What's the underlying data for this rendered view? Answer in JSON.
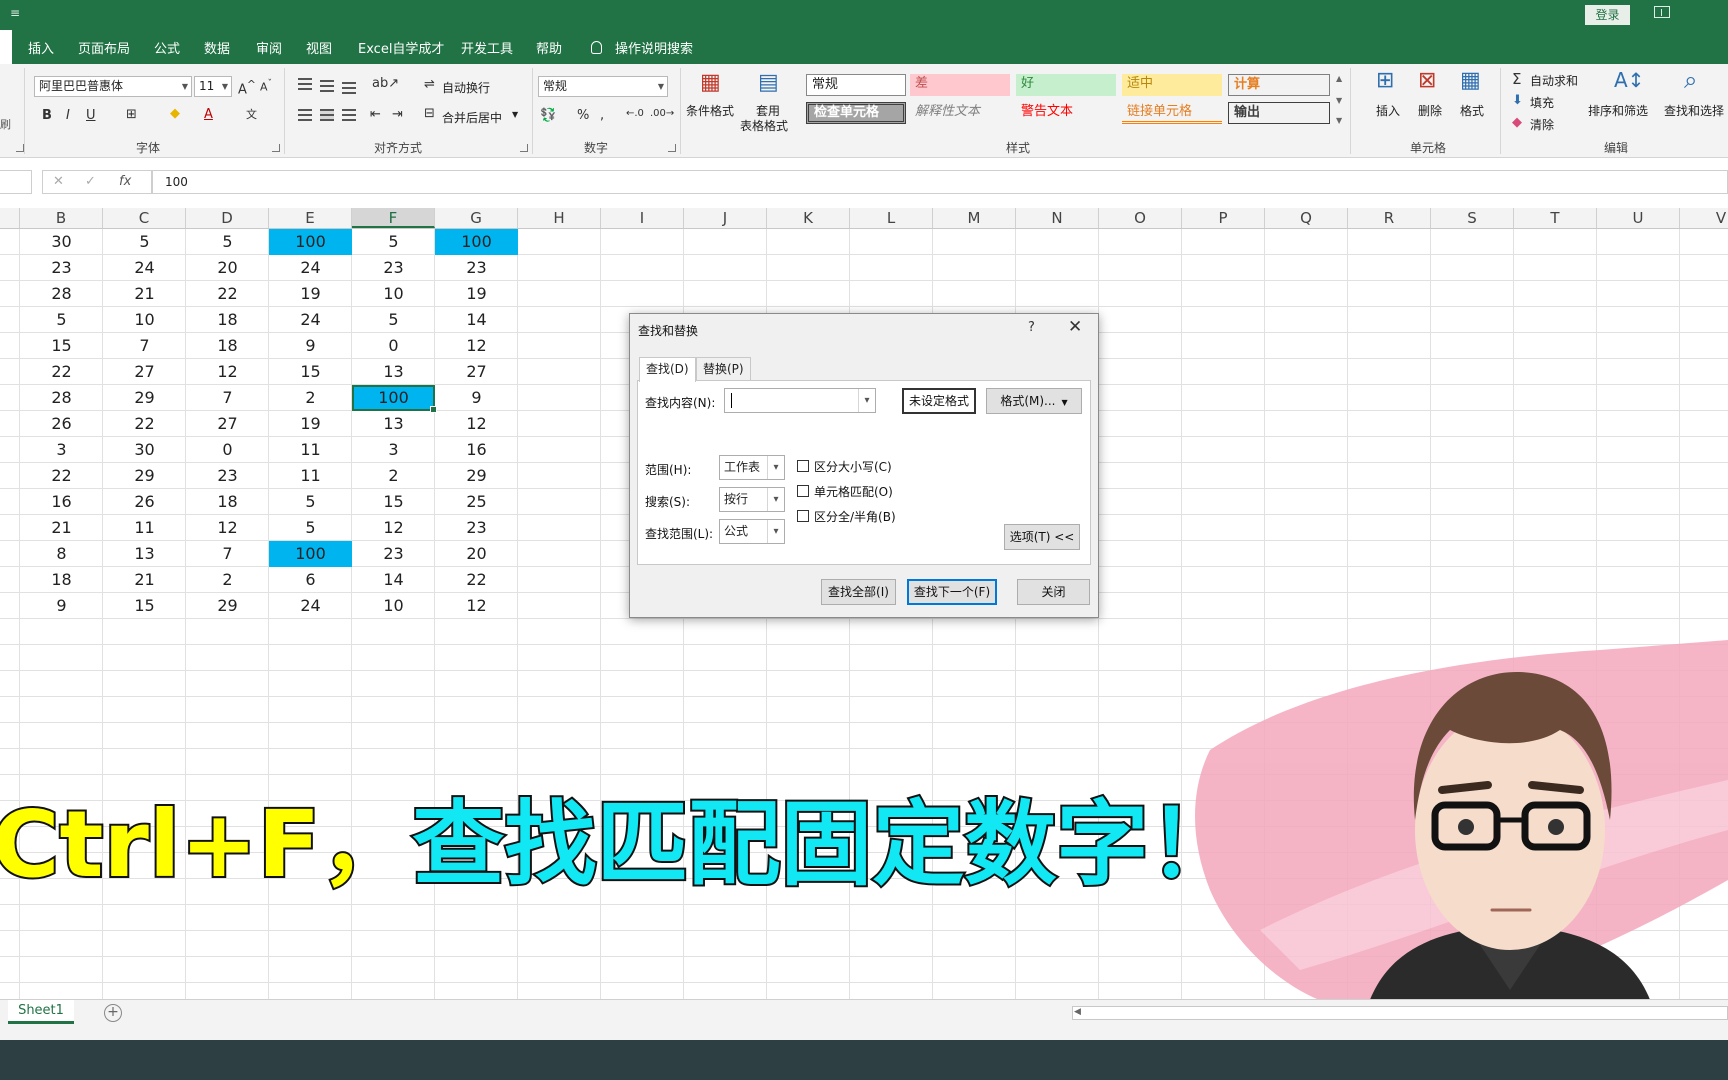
{
  "titlebar": {
    "qat_mark": "≡",
    "login": "登录"
  },
  "tabs": [
    "插入",
    "页面布局",
    "公式",
    "数据",
    "审阅",
    "视图",
    "Excel自学成才",
    "开发工具",
    "帮助",
    "操作说明搜索"
  ],
  "ribbon": {
    "font_name": "阿里巴巴普惠体",
    "font_size": "11",
    "wrap_text": "自动换行",
    "merge_center": "合并后居中",
    "number_format": "常规",
    "cond_format": "条件格式",
    "table_format_1": "套用",
    "table_format_2": "表格格式",
    "styles": {
      "normal": "常规",
      "bad": "差",
      "good": "好",
      "neutral": "适中",
      "calc": "计算",
      "check": "检查单元格",
      "explain": "解释性文本",
      "warning": "警告文本",
      "link": "链接单元格",
      "output": "输出"
    },
    "insert": "插入",
    "delete": "删除",
    "format": "格式",
    "autosum": "自动求和",
    "fill": "填充",
    "clear": "清除",
    "sort_filter": "排序和筛选",
    "find_select": "查找和选择",
    "groups": {
      "font": "字体",
      "align": "对齐方式",
      "number": "数字",
      "styles": "样式",
      "cells": "单元格",
      "edit": "编辑"
    }
  },
  "formula_bar": {
    "cancel": "✕",
    "enter": "✓",
    "fx": "fx",
    "value": "100"
  },
  "grid": {
    "columns": [
      "B",
      "C",
      "D",
      "E",
      "F",
      "G",
      "H",
      "I",
      "J",
      "K",
      "L",
      "M",
      "N",
      "O",
      "P",
      "Q",
      "R",
      "S",
      "T",
      "U",
      "V"
    ],
    "selected_column": "F",
    "rows": [
      [
        "30",
        "5",
        "5",
        "100",
        "5",
        "100"
      ],
      [
        "23",
        "24",
        "20",
        "24",
        "23",
        "23"
      ],
      [
        "28",
        "21",
        "22",
        "19",
        "10",
        "19"
      ],
      [
        "5",
        "10",
        "18",
        "24",
        "5",
        "14"
      ],
      [
        "15",
        "7",
        "18",
        "9",
        "0",
        "12"
      ],
      [
        "22",
        "27",
        "12",
        "15",
        "13",
        "27"
      ],
      [
        "28",
        "29",
        "7",
        "2",
        "100",
        "9"
      ],
      [
        "26",
        "22",
        "27",
        "19",
        "13",
        "12"
      ],
      [
        "3",
        "30",
        "0",
        "11",
        "3",
        "16"
      ],
      [
        "22",
        "29",
        "23",
        "11",
        "2",
        "29"
      ],
      [
        "16",
        "26",
        "18",
        "5",
        "15",
        "25"
      ],
      [
        "21",
        "11",
        "12",
        "5",
        "12",
        "23"
      ],
      [
        "8",
        "13",
        "7",
        "100",
        "23",
        "20"
      ],
      [
        "18",
        "21",
        "2",
        "6",
        "14",
        "22"
      ],
      [
        "9",
        "15",
        "29",
        "24",
        "10",
        "12"
      ]
    ],
    "highlight_color": "#00b4f0"
  },
  "dialog": {
    "title": "查找和替换",
    "help": "?",
    "close": "✕",
    "tab_find": "查找(D)",
    "tab_replace": "替换(P)",
    "find_label": "查找内容(N):",
    "find_value": "",
    "no_format": "未设定格式",
    "format_btn": "格式(M)...",
    "within_label": "范围(H):",
    "within_value": "工作表",
    "search_label": "搜索(S):",
    "search_value": "按行",
    "lookin_label": "查找范围(L):",
    "lookin_value": "公式",
    "match_case": "区分大小写(C)",
    "match_cell": "单元格匹配(O)",
    "match_width": "区分全/半角(B)",
    "options_btn": "选项(T) <<",
    "find_all": "查找全部(I)",
    "find_next": "查找下一个(F)",
    "close_btn": "关闭"
  },
  "sheets": {
    "active": "Sheet1",
    "add": "+"
  },
  "caption": {
    "part1": "Ctrl+F，",
    "part2": "查找匹配固定数字！"
  },
  "colors": {
    "excel_green": "#217346",
    "caption_yellow": "#ffff00",
    "caption_cyan": "#12e8f4"
  }
}
